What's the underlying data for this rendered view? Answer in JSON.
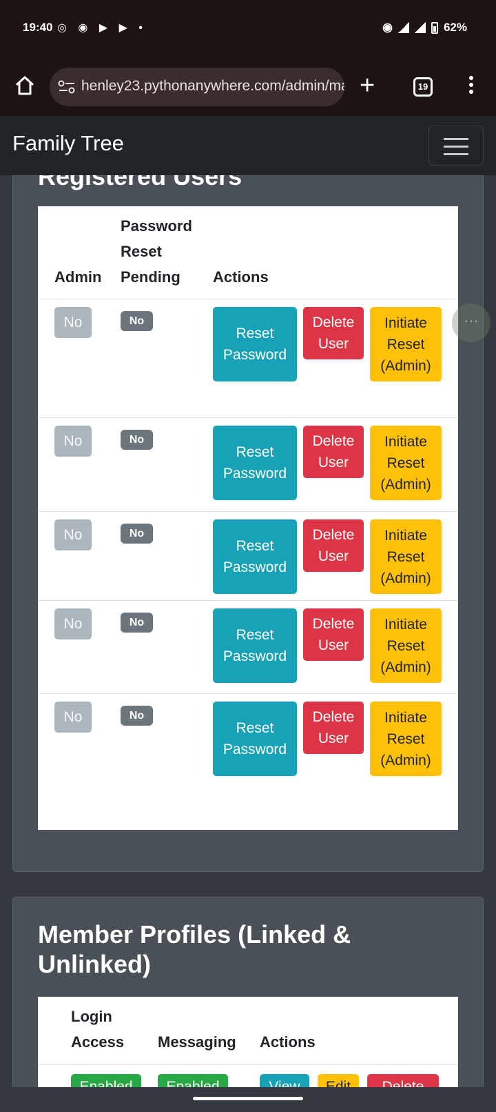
{
  "status_bar": {
    "time": "19:40",
    "left_icons": [
      "whatsapp-icon",
      "record-icon",
      "android-auto-icon",
      "android-auto-icon",
      "dot-icon"
    ],
    "battery": "62%",
    "network": "4G"
  },
  "browser": {
    "url": "henley23.pythonanywhere.com/admin/ma",
    "tab_count": "19"
  },
  "navbar": {
    "brand": "Family Tree"
  },
  "users_section": {
    "title": "Registered Users",
    "headers": {
      "admin": "Admin",
      "reset_pending_1": "Password",
      "reset_pending_2": "Reset",
      "reset_pending_3": "Pending",
      "actions": "Actions"
    },
    "rows": [
      {
        "admin": "No",
        "pending": "No",
        "reset": [
          "Reset",
          "Password"
        ],
        "delete": [
          "Delete",
          "User"
        ],
        "initiate": [
          "Initiate",
          "Reset",
          "(Admin)"
        ]
      },
      {
        "admin": "No",
        "pending": "No",
        "reset": [
          "Reset",
          "Password"
        ],
        "delete": [
          "Delete",
          "User"
        ],
        "initiate": [
          "Initiate",
          "Reset",
          "(Admin)"
        ]
      },
      {
        "admin": "No",
        "pending": "No",
        "reset": [
          "Reset",
          "Password"
        ],
        "delete": [
          "Delete",
          "User"
        ],
        "initiate": [
          "Initiate",
          "Reset",
          "(Admin)"
        ]
      },
      {
        "admin": "No",
        "pending": "No",
        "reset": [
          "Reset",
          "Password"
        ],
        "delete": [
          "Delete",
          "User"
        ],
        "initiate": [
          "Initiate",
          "Reset",
          "(Admin)"
        ]
      },
      {
        "admin": "No",
        "pending": "No",
        "reset": [
          "Reset",
          "Password"
        ],
        "delete": [
          "Delete",
          "User"
        ],
        "initiate": [
          "Initiate",
          "Reset",
          "(Admin)"
        ]
      }
    ]
  },
  "members_section": {
    "title": "Member Profiles (Linked & Unlinked)",
    "headers": {
      "login_1": "Login",
      "login_2": "Access",
      "messaging": "Messaging",
      "actions": "Actions"
    },
    "first_row": {
      "login": "Enabled",
      "messaging": "Enabled",
      "view": "View",
      "edit": "Edit",
      "delete": "Delete"
    }
  },
  "colors": {
    "info": "#17a2b8",
    "danger": "#dc3545",
    "warning": "#ffc107",
    "success": "#28a745",
    "secondary": "#6c757d"
  }
}
